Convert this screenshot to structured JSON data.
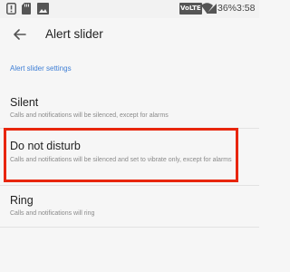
{
  "status_bar": {
    "network_badge": "VoLTE",
    "battery": "36%",
    "time": "3:58"
  },
  "toolbar": {
    "title": "Alert slider"
  },
  "section": {
    "header": "Alert slider settings"
  },
  "options": [
    {
      "title": "Silent",
      "summary": "Calls and notifications will be silenced, except for alarms"
    },
    {
      "title": "Do not disturb",
      "summary": "Calls and notifications will be silenced and set to vibrate only, except for alarms",
      "highlighted": true
    },
    {
      "title": "Ring",
      "summary": "Calls and notifications will ring"
    }
  ],
  "colors": {
    "accent": "#3f7fd6",
    "highlight_border": "#e8260d"
  }
}
